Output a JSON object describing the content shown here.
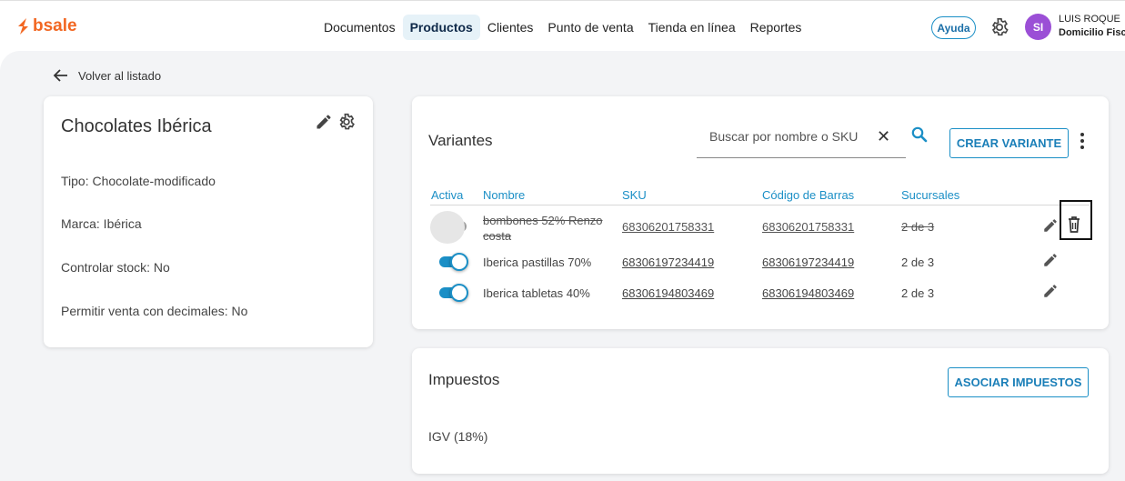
{
  "header": {
    "brand": "bsale",
    "nav": [
      "Documentos",
      "Productos",
      "Clientes",
      "Punto de venta",
      "Tienda en línea",
      "Reportes"
    ],
    "active_nav": "Productos",
    "help_label": "Ayuda",
    "avatar_initials": "SI",
    "user_name": "LUIS ROQUE",
    "user_sub": "Domicilio Fisca"
  },
  "back_label": "Volver al listado",
  "product": {
    "title": "Chocolates Ibérica",
    "tipo": "Tipo: Chocolate-modificado",
    "marca": "Marca: Ibérica",
    "controlar_stock": "Controlar stock: No",
    "permitir_decimales": "Permitir venta con decimales: No"
  },
  "variants": {
    "title": "Variantes",
    "search_placeholder": "Buscar por nombre o SKU",
    "clear_label": "✕",
    "create_label": "CREAR VARIANTE",
    "columns": [
      "Activa",
      "Nombre",
      "SKU",
      "Código de Barras",
      "Sucursales"
    ],
    "rows": [
      {
        "active": false,
        "name_line1": "bombones 52% Renzo",
        "name_line2": "costa",
        "sku": "68306201758331",
        "barcode": "68306201758331",
        "branches": "2 de 3",
        "struck": true
      },
      {
        "active": true,
        "name_line1": "Iberica pastillas 70%",
        "name_line2": "",
        "sku": "68306197234419",
        "barcode": "68306197234419",
        "branches": "2 de 3",
        "struck": false
      },
      {
        "active": true,
        "name_line1": "Iberica tabletas 40%",
        "name_line2": "",
        "sku": "68306194803469",
        "barcode": "68306194803469",
        "branches": "2 de 3",
        "struck": false
      }
    ]
  },
  "taxes": {
    "title": "Impuestos",
    "associate_label": "ASOCIAR IMPUESTOS",
    "value": "IGV (18%)"
  },
  "colors": {
    "brand": "#f26722",
    "accent": "#1b8fc6",
    "avatar": "#9b4fd6"
  }
}
